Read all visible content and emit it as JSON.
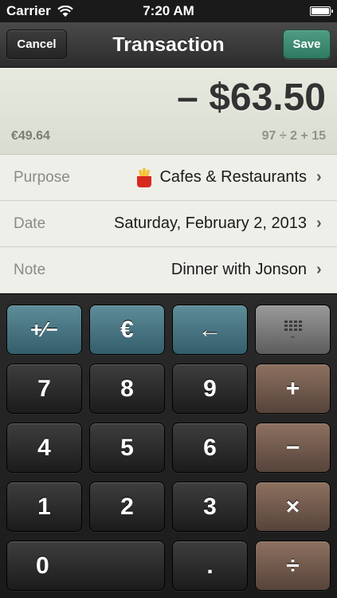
{
  "status_bar": {
    "carrier": "Carrier",
    "time": "7:20 AM",
    "battery_level": 1.0
  },
  "nav": {
    "title": "Transaction",
    "cancel_label": "Cancel",
    "save_label": "Save"
  },
  "amount": {
    "main": "– $63.50",
    "alt_currency": "€49.64",
    "expression": "97 ÷ 2 + 15"
  },
  "rows": [
    {
      "label": "Purpose",
      "value": "Cafes & Restaurants",
      "icon": "fries-icon"
    },
    {
      "label": "Date",
      "value": "Saturday, February 2, 2013"
    },
    {
      "label": "Note",
      "value": "Dinner with Jonson"
    }
  ],
  "keypad": {
    "plus_minus": "+⁄−",
    "currency": "€",
    "backspace": "←",
    "hide_icon": "keyboard-hide-icon",
    "digits": [
      "7",
      "8",
      "9",
      "4",
      "5",
      "6",
      "1",
      "2",
      "3",
      "0",
      "."
    ],
    "ops": {
      "plus": "+",
      "minus": "−",
      "times": "×",
      "divide": "÷"
    }
  },
  "colors": {
    "accent_green": "#3f8c73",
    "teal": "#4a7784",
    "brown": "#735a4d"
  }
}
